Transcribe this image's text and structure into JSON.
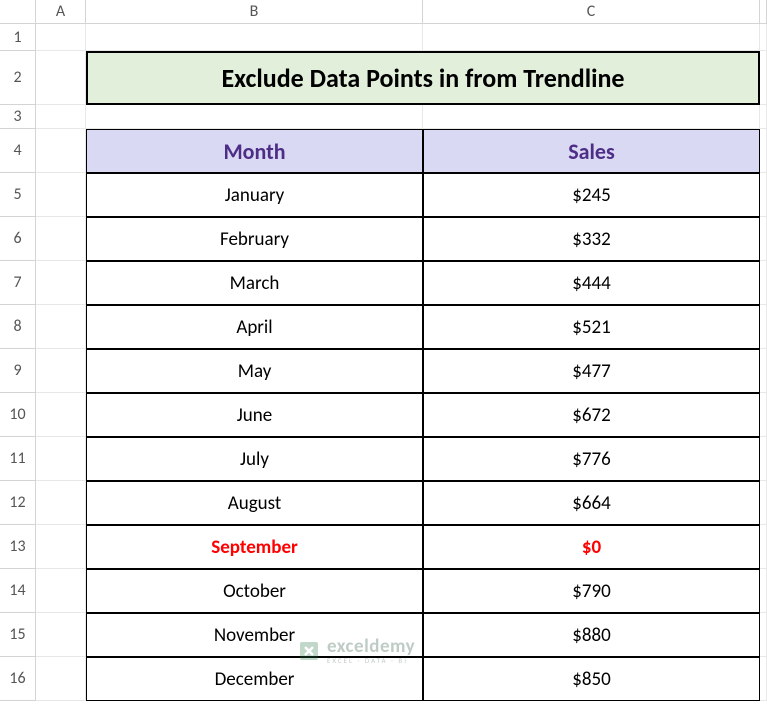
{
  "columns": [
    "A",
    "B",
    "C"
  ],
  "rows": [
    "1",
    "2",
    "3",
    "4",
    "5",
    "6",
    "7",
    "8",
    "9",
    "10",
    "11",
    "12",
    "13",
    "14",
    "15",
    "16"
  ],
  "title": "Exclude Data Points in from Trendline",
  "headers": {
    "month": "Month",
    "sales": "Sales"
  },
  "chart_data": {
    "type": "table",
    "title": "Exclude Data Points in from Trendline",
    "columns": [
      "Month",
      "Sales"
    ],
    "rows": [
      {
        "month": "January",
        "sales": "$245",
        "highlight": false
      },
      {
        "month": "February",
        "sales": "$332",
        "highlight": false
      },
      {
        "month": "March",
        "sales": "$444",
        "highlight": false
      },
      {
        "month": "April",
        "sales": "$521",
        "highlight": false
      },
      {
        "month": "May",
        "sales": "$477",
        "highlight": false
      },
      {
        "month": "June",
        "sales": "$672",
        "highlight": false
      },
      {
        "month": "July",
        "sales": "$776",
        "highlight": false
      },
      {
        "month": "August",
        "sales": "$664",
        "highlight": false
      },
      {
        "month": "September",
        "sales": "$0",
        "highlight": true
      },
      {
        "month": "October",
        "sales": "$790",
        "highlight": false
      },
      {
        "month": "November",
        "sales": "$880",
        "highlight": false
      },
      {
        "month": "December",
        "sales": "$850",
        "highlight": false
      }
    ]
  },
  "watermark": {
    "main": "exceldemy",
    "sub": "EXCEL · DATA · BI"
  }
}
